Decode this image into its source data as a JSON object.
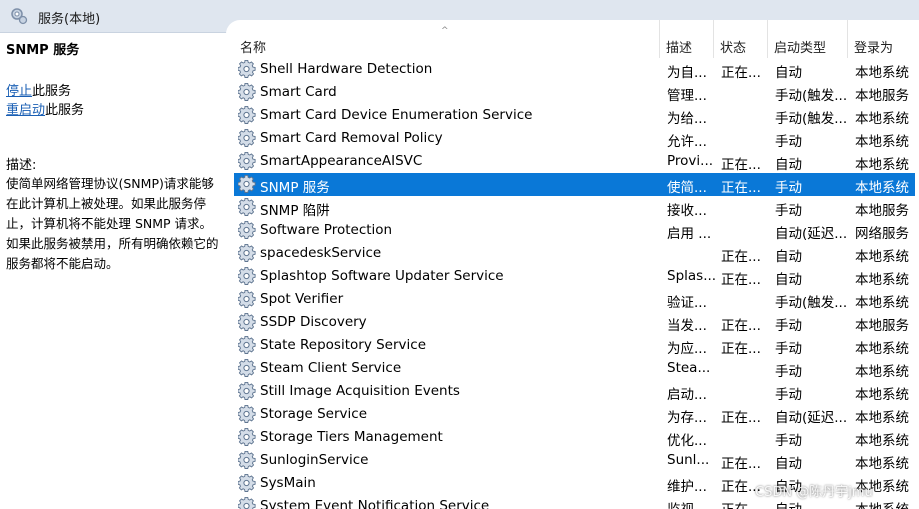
{
  "window": {
    "title": "服务(本地)",
    "icon": "services-icon"
  },
  "left_pane": {
    "service_name": "SNMP 服务",
    "actions": [
      {
        "link": "停止",
        "suffix": "此服务"
      },
      {
        "link": "重启动",
        "suffix": "此服务"
      }
    ],
    "description_label": "描述:",
    "description": "使简单网络管理协议(SNMP)请求能够在此计算机上被处理。如果此服务停止，计算机将不能处理 SNMP 请求。如果此服务被禁用，所有明确依赖它的服务都将不能启动。"
  },
  "list": {
    "columns": [
      "名称",
      "描述",
      "状态",
      "启动类型",
      "登录为"
    ],
    "sort_indicator": "^",
    "selected_index": 5,
    "rows": [
      {
        "name": "Shell Hardware Detection",
        "desc": "为自...",
        "status": "正在...",
        "startup": "自动",
        "logon": "本地系统"
      },
      {
        "name": "Smart Card",
        "desc": "管理...",
        "status": "",
        "startup": "手动(触发...",
        "logon": "本地服务"
      },
      {
        "name": "Smart Card Device Enumeration Service",
        "desc": "为给...",
        "status": "",
        "startup": "手动(触发...",
        "logon": "本地系统"
      },
      {
        "name": "Smart Card Removal Policy",
        "desc": "允许...",
        "status": "",
        "startup": "手动",
        "logon": "本地系统"
      },
      {
        "name": "SmartAppearanceAISVC",
        "desc": "Provi...",
        "status": "正在...",
        "startup": "自动",
        "logon": "本地系统"
      },
      {
        "name": "SNMP 服务",
        "desc": "使简...",
        "status": "正在...",
        "startup": "手动",
        "logon": "本地系统"
      },
      {
        "name": "SNMP 陷阱",
        "desc": "接收...",
        "status": "",
        "startup": "手动",
        "logon": "本地服务"
      },
      {
        "name": "Software Protection",
        "desc": "启用 ...",
        "status": "",
        "startup": "自动(延迟...",
        "logon": "网络服务"
      },
      {
        "name": "spacedeskService",
        "desc": "",
        "status": "正在...",
        "startup": "自动",
        "logon": "本地系统"
      },
      {
        "name": "Splashtop Software Updater Service",
        "desc": "Splas...",
        "status": "正在...",
        "startup": "自动",
        "logon": "本地系统"
      },
      {
        "name": "Spot Verifier",
        "desc": "验证...",
        "status": "",
        "startup": "手动(触发...",
        "logon": "本地系统"
      },
      {
        "name": "SSDP Discovery",
        "desc": "当发...",
        "status": "正在...",
        "startup": "手动",
        "logon": "本地服务"
      },
      {
        "name": "State Repository Service",
        "desc": "为应...",
        "status": "正在...",
        "startup": "手动",
        "logon": "本地系统"
      },
      {
        "name": "Steam Client Service",
        "desc": "Stea...",
        "status": "",
        "startup": "手动",
        "logon": "本地系统"
      },
      {
        "name": "Still Image Acquisition Events",
        "desc": "启动...",
        "status": "",
        "startup": "手动",
        "logon": "本地系统"
      },
      {
        "name": "Storage Service",
        "desc": "为存...",
        "status": "正在...",
        "startup": "自动(延迟...",
        "logon": "本地系统"
      },
      {
        "name": "Storage Tiers Management",
        "desc": "优化...",
        "status": "",
        "startup": "手动",
        "logon": "本地系统"
      },
      {
        "name": "SunloginService",
        "desc": "Sunl...",
        "status": "正在...",
        "startup": "自动",
        "logon": "本地系统"
      },
      {
        "name": "SysMain",
        "desc": "维护...",
        "status": "正在...",
        "startup": "自动",
        "logon": "本地系统"
      },
      {
        "name": "System Event Notification Service",
        "desc": "监视...",
        "status": "正在...",
        "startup": "自动",
        "logon": "本地系统"
      }
    ]
  },
  "watermark": "CSDN @陈丹宇jmu",
  "colors": {
    "selection": "#0a78d7",
    "link": "#1a5fb4",
    "titlebar": "#dfe6ef"
  }
}
